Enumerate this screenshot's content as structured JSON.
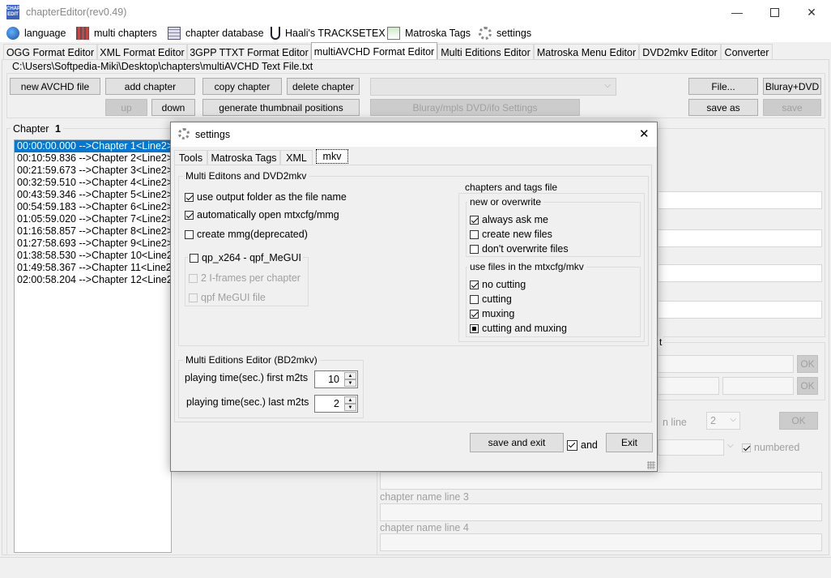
{
  "window": {
    "title": "chapterEditor(rev0.49)"
  },
  "menu": {
    "items": [
      {
        "label": "language"
      },
      {
        "label": "multi chapters"
      },
      {
        "label": "chapter database"
      },
      {
        "label": "Haali's TRACKSETEX"
      },
      {
        "label": "Matroska Tags"
      },
      {
        "label": "settings"
      }
    ]
  },
  "tabs": [
    "OGG Format Editor",
    "XML Format Editor",
    "3GPP TTXT Format Editor",
    "multiAVCHD Format Editor",
    "Multi Editions Editor",
    "Matroska Menu Editor",
    "DVD2mkv Editor",
    "Converter"
  ],
  "file_path": "C:\\Users\\Softpedia-Miki\\Desktop\\chapters\\multiAVCHD Text File.txt",
  "toolbar": {
    "new_avchd": "new AVCHD file",
    "add_chapter": "add chapter",
    "copy_chapter": "copy chapter",
    "delete_chapter": "delete chapter",
    "up": "up",
    "down": "down",
    "generate_thumbs": "generate thumbnail positions",
    "bluray_settings": "Bluray/mpls DVD/ifo Settings",
    "file": "File...",
    "bluray_dvd": "Bluray+DVD",
    "save_as": "save as",
    "save": "save"
  },
  "chapter_panel": {
    "label": "Chapter",
    "number": "1",
    "items": [
      "00:00:00.000 -->Chapter 1<Line2>",
      "00:10:59.836 -->Chapter 2<Line2>",
      "00:21:59.673 -->Chapter 3<Line2>",
      "00:32:59.510 -->Chapter 4<Line2>",
      "00:43:59.346 -->Chapter 5<Line2>",
      "00:54:59.183 -->Chapter 6<Line2>",
      "01:05:59.020 -->Chapter 7<Line2>",
      "01:16:58.857 -->Chapter 8<Line2>",
      "01:27:58.693 -->Chapter 9<Line2>",
      "01:38:58.530 -->Chapter 10<Line2>",
      "01:49:58.367 -->Chapter 11<Line2>",
      "02:00:58.204 -->Chapter 12<Line2>"
    ]
  },
  "right_panel": {
    "frag_t": "t",
    "ok": "OK",
    "frag_n_line": "n line",
    "line_count": "2",
    "numbered": "numbered",
    "chapter_name_line_3": "chapter name line 3",
    "chapter_name_line_4": "chapter name line 4"
  },
  "dialog": {
    "title": "settings",
    "tabs": [
      "Tools",
      "Matroska Tags",
      "XML",
      "mkv"
    ],
    "multi_editions_group": "Multi Editons and DVD2mkv",
    "use_output_folder": "use output folder as the file name",
    "auto_open": "automatically open mtxcfg/mmg",
    "create_mmg": "create mmg(deprecated)",
    "qp_group": "qp_x264 - qpf_MeGUI",
    "iframes": "2 I-frames per chapter",
    "qpf_file": "qpf MeGUI file",
    "chapters_tags_group": "chapters and tags file",
    "new_overwrite_group": "new or overwrite",
    "always_ask": "always ask me",
    "create_new": "create new files",
    "dont_overwrite": "don't overwrite files",
    "use_files_group": "use files in the mtxcfg/mkv",
    "no_cutting": "no cutting",
    "cutting": "cutting",
    "muxing": "muxing",
    "cutting_muxing": "cutting and muxing",
    "me_group": "Multi Editions Editor (BD2mkv)",
    "first_m2ts_label": "playing time(sec.) first m2ts",
    "first_m2ts_value": "10",
    "last_m2ts_label": "playing time(sec.) last m2ts",
    "last_m2ts_value": "2",
    "save_exit": "save and exit",
    "and": "and",
    "exit": "Exit"
  },
  "colors": {
    "selection": "#0078d7",
    "window_bg": "#f0f0f0"
  }
}
